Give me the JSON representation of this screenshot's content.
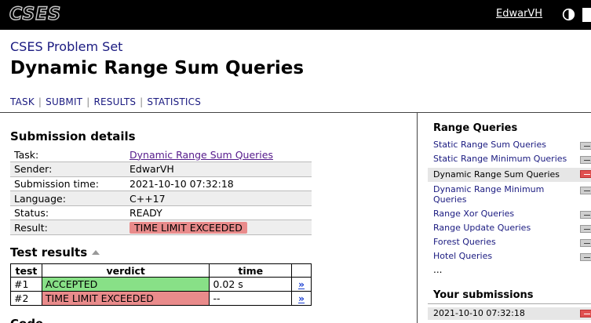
{
  "header": {
    "logo": "CSES",
    "username": "EdwarVH",
    "theme_icon": "half-circle-icon",
    "logout_icon": "logout-icon"
  },
  "site_title": "CSES Problem Set",
  "page_title": "Dynamic Range Sum Queries",
  "tabs": [
    "TASK",
    "SUBMIT",
    "RESULTS",
    "STATISTICS"
  ],
  "details": {
    "title": "Submission details",
    "rows": [
      {
        "key": "Task:",
        "value": "Dynamic Range Sum Queries"
      },
      {
        "key": "Sender:",
        "value": "EdwarVH"
      },
      {
        "key": "Submission time:",
        "value": "2021-10-10 07:32:18"
      },
      {
        "key": "Language:",
        "value": "C++17"
      },
      {
        "key": "Status:",
        "value": "READY"
      },
      {
        "key": "Result:",
        "value": "TIME LIMIT EXCEEDED"
      }
    ]
  },
  "tests": {
    "title": "Test results",
    "headers": [
      "test",
      "verdict",
      "time"
    ],
    "rows": [
      {
        "test": "#1",
        "verdict": "ACCEPTED",
        "time": "0.02 s",
        "link": "»"
      },
      {
        "test": "#2",
        "verdict": "TIME LIMIT EXCEEDED",
        "time": "--",
        "link": "»"
      }
    ]
  },
  "next_section_partial": "Code",
  "sidebar": {
    "title": "Range Queries",
    "items": [
      {
        "label": "Static Range Sum Queries",
        "active": false
      },
      {
        "label": "Static Range Minimum Queries",
        "active": false
      },
      {
        "label": "Dynamic Range Sum Queries",
        "active": true
      },
      {
        "label": "Dynamic Range Minimum Queries",
        "active": false
      },
      {
        "label": "Range Xor Queries",
        "active": false
      },
      {
        "label": "Range Update Queries",
        "active": false
      },
      {
        "label": "Forest Queries",
        "active": false
      },
      {
        "label": "Hotel Queries",
        "active": false
      }
    ],
    "more": "...",
    "submissions_title": "Your submissions",
    "submissions": [
      "2021-10-10 07:32:18"
    ]
  },
  "colors": {
    "accepted": "#88e087",
    "failed": "#e98b8b",
    "link": "#1a1a80"
  }
}
